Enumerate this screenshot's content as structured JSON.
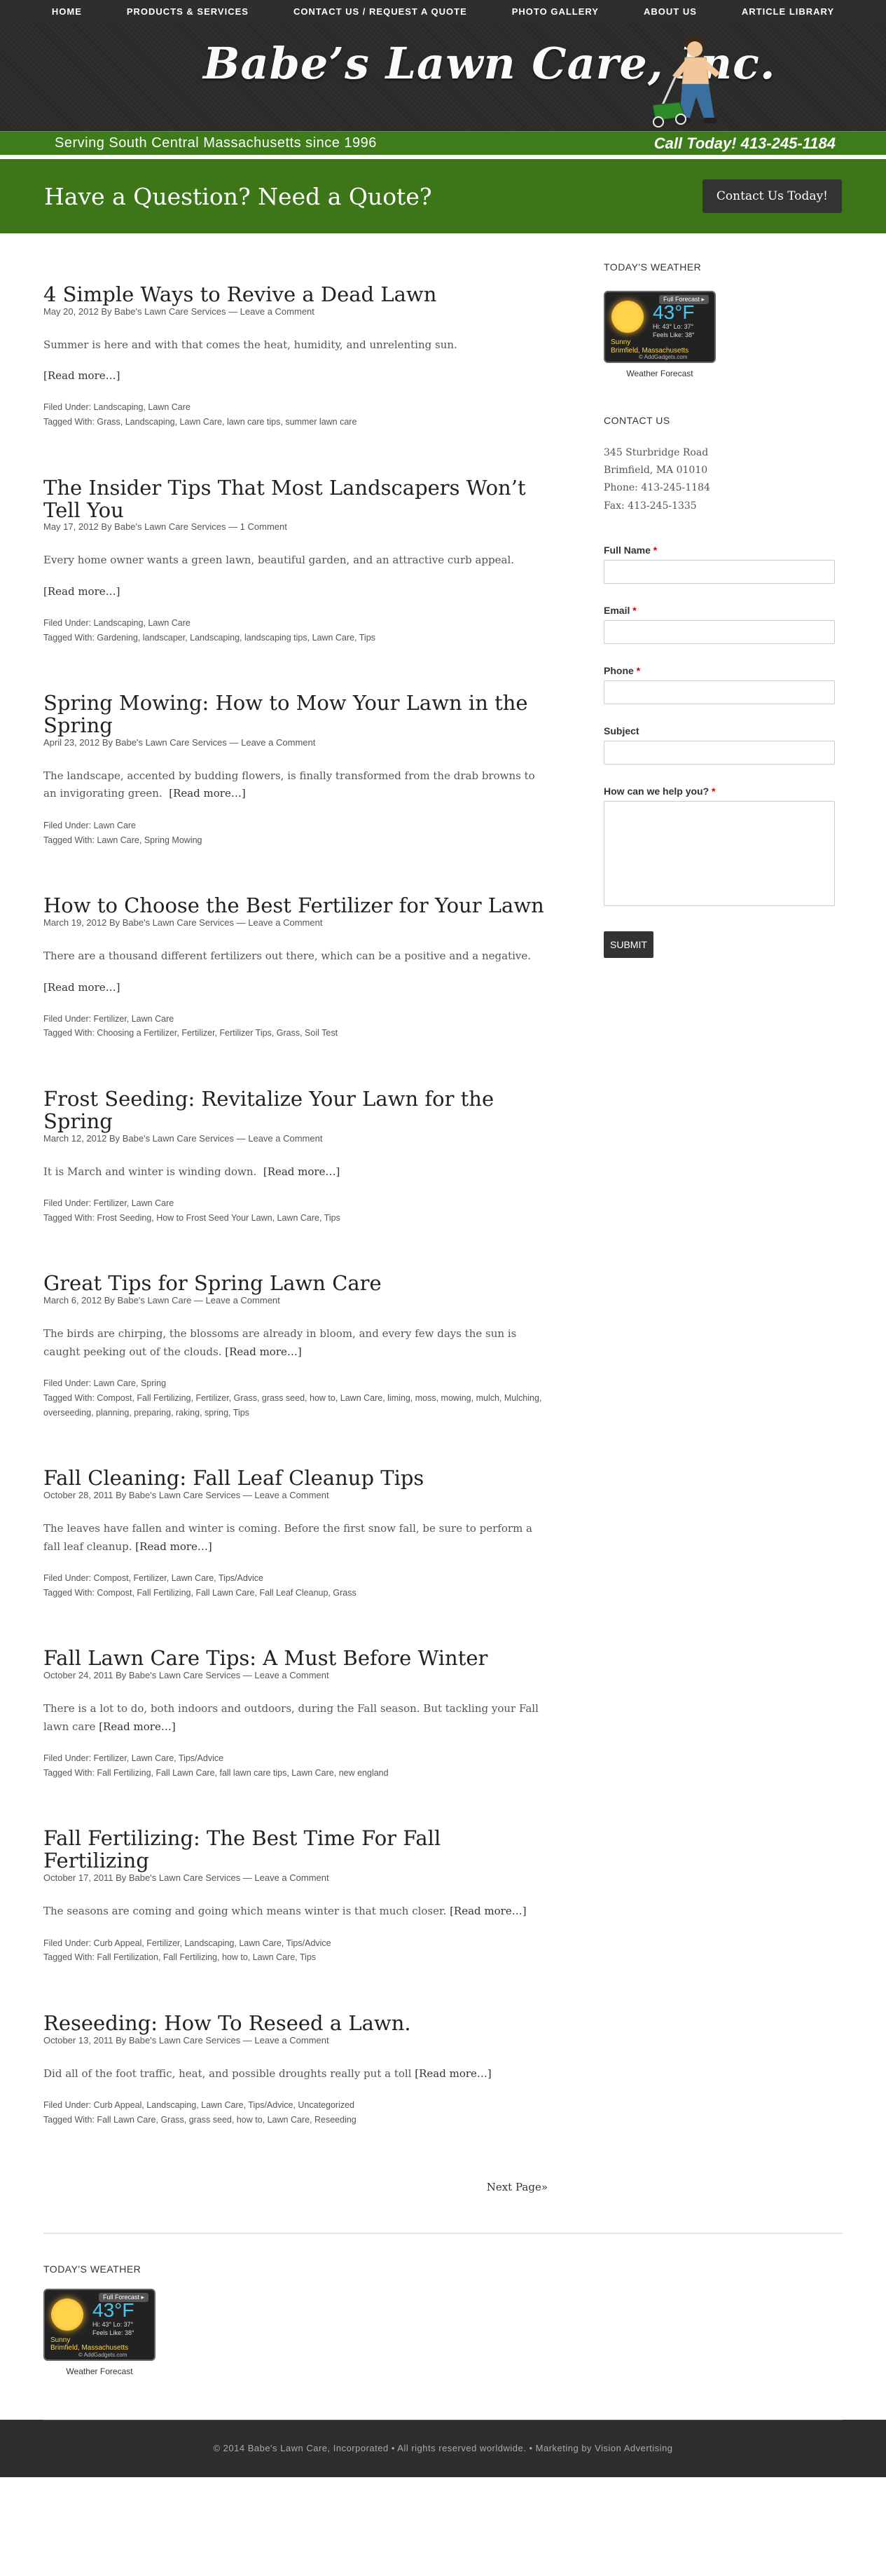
{
  "nav": {
    "items": [
      {
        "label": "HOME"
      },
      {
        "label": "PRODUCTS & SERVICES"
      },
      {
        "label": "CONTACT US / REQUEST A QUOTE"
      },
      {
        "label": "PHOTO GALLERY"
      },
      {
        "label": "ABOUT US"
      },
      {
        "label": "ARTICLE LIBRARY"
      }
    ]
  },
  "header": {
    "logo_text": "Babe’s Lawn Care, Inc.",
    "tagline": "Serving South Central Massachusetts since 1996",
    "call_text": "Call Today! 413-245-1184"
  },
  "quote_band": {
    "heading": "Have a Question? Need a Quote?",
    "button_label": "Contact Us Today!"
  },
  "posts": [
    {
      "title": "4 Simple Ways to Revive a Dead Lawn",
      "meta": "May 20, 2012 By Babe's Lawn Care Services — Leave a Comment",
      "excerpt": "Summer is here and with that comes the heat, humidity, and unrelenting sun.",
      "read_more": "[Read more…]",
      "filed": "Filed Under: Landscaping, Lawn Care",
      "tagged": "Tagged With: Grass, Landscaping, Lawn Care, lawn care tips, summer lawn care"
    },
    {
      "title": "The Insider Tips That Most Landscapers Won’t Tell You",
      "meta": "May 17, 2012 By Babe's Lawn Care Services — 1 Comment",
      "excerpt": "Every home owner wants a green lawn, beautiful garden, and an attractive curb appeal.",
      "read_more": "[Read more…]",
      "filed": "Filed Under: Landscaping, Lawn Care",
      "tagged": "Tagged With: Gardening, landscaper, Landscaping, landscaping tips, Lawn Care, Tips"
    },
    {
      "title": "Spring Mowing: How to Mow Your Lawn in the Spring",
      "meta": "April 23, 2012 By Babe's Lawn Care Services — Leave a Comment",
      "excerpt": "The landscape, accented by budding flowers, is finally transformed from the drab browns to an invigorating green.",
      "read_more": "[Read more…]",
      "filed": "Filed Under: Lawn Care",
      "tagged": "Tagged With: Lawn Care, Spring Mowing"
    },
    {
      "title": "How to Choose the Best Fertilizer for Your Lawn",
      "meta": "March 19, 2012 By Babe's Lawn Care Services — Leave a Comment",
      "excerpt": "There are a thousand different fertilizers out there, which can be a positive and a negative.",
      "read_more": "[Read more…]",
      "filed": "Filed Under: Fertilizer, Lawn Care",
      "tagged": "Tagged With: Choosing a Fertilizer, Fertilizer, Fertilizer Tips, Grass, Soil Test"
    },
    {
      "title": "Frost Seeding: Revitalize Your Lawn for the Spring",
      "meta": "March 12, 2012 By Babe's Lawn Care Services — Leave a Comment",
      "excerpt": "It is March and winter is winding down.",
      "read_more": "[Read more…]",
      "filed": "Filed Under: Fertilizer, Lawn Care",
      "tagged": "Tagged With: Frost Seeding, How to Frost Seed Your Lawn, Lawn Care, Tips"
    },
    {
      "title": "Great Tips for Spring Lawn Care",
      "meta": "March 6, 2012 By Babe's Lawn Care — Leave a Comment",
      "excerpt": "The birds are chirping, the blossoms are already in bloom, and every few days the sun is caught peeking out of the clouds.",
      "read_more": "[Read more…]",
      "filed": "Filed Under: Lawn Care, Spring",
      "tagged": "Tagged With: Compost, Fall Fertilizing, Fertilizer, Grass, grass seed, how to, Lawn Care, liming, moss, mowing, mulch, Mulching, overseeding, planning, preparing, raking, spring, Tips"
    },
    {
      "title": "Fall Cleaning: Fall Leaf Cleanup Tips",
      "meta": "October 28, 2011 By Babe's Lawn Care Services — Leave a Comment",
      "excerpt": "The leaves have fallen and winter is coming. Before the first snow fall, be sure to perform a fall leaf cleanup.",
      "read_more": "[Read more…]",
      "filed": "Filed Under: Compost, Fertilizer, Lawn Care, Tips/Advice",
      "tagged": "Tagged With: Compost, Fall Fertilizing, Fall Lawn Care, Fall Leaf Cleanup, Grass"
    },
    {
      "title": "Fall Lawn Care Tips: A Must Before Winter",
      "meta": "October 24, 2011 By Babe's Lawn Care Services — Leave a Comment",
      "excerpt": "There is a lot to do, both indoors and outdoors, during the Fall season. But tackling your Fall lawn care",
      "read_more": "[Read more…]",
      "filed": "Filed Under: Fertilizer, Lawn Care, Tips/Advice",
      "tagged": "Tagged With: Fall Fertilizing, Fall Lawn Care, fall lawn care tips, Lawn Care, new england"
    },
    {
      "title": "Fall Fertilizing: The Best Time For Fall Fertilizing",
      "meta": "October 17, 2011 By Babe's Lawn Care Services — Leave a Comment",
      "excerpt": "The seasons are coming and going which means winter is that much closer.",
      "read_more": "[Read more…]",
      "filed": "Filed Under: Curb Appeal, Fertilizer, Landscaping, Lawn Care, Tips/Advice",
      "tagged": "Tagged With: Fall Fertilization, Fall Fertilizing, how to, Lawn Care, Tips"
    },
    {
      "title": "Reseeding: How To Reseed a Lawn.",
      "meta": "October 13, 2011 By Babe's Lawn Care Services — Leave a Comment",
      "excerpt": "Did all of the foot traffic, heat, and possible droughts really put a toll",
      "read_more": "[Read more…]",
      "filed": "Filed Under: Curb Appeal, Landscaping, Lawn Care, Tips/Advice, Uncategorized",
      "tagged": "Tagged With: Fall Lawn Care, Grass, grass seed, how to, Lawn Care, Reseeding"
    }
  ],
  "pagination": {
    "next_label": "Next Page»"
  },
  "weather": {
    "title": "TODAY'S WEATHER",
    "forecast_tab": "Full Forecast ▸",
    "temp": "43°F",
    "hilo": "Hi: 43°  Lo: 37°",
    "feels": "Feels Like: 38°",
    "condition": "Sunny",
    "location": "Brimfield, Massachusetts",
    "brand": "© AddGadgets.com",
    "caption": "Weather Forecast"
  },
  "contact": {
    "title": "CONTACT US",
    "address1": "345 Sturbridge Road",
    "address2": "Brimfield, MA 01010",
    "phone": "Phone: 413-245-1184",
    "fax": "Fax: 413-245-1335"
  },
  "form": {
    "full_name": "Full Name",
    "email": "Email",
    "phone": "Phone",
    "subject": "Subject",
    "message": "How can we help you?",
    "required_mark": "*",
    "submit": "SUBMIT"
  },
  "footer": {
    "text": "© 2014 Babe's Lawn Care, Incorporated • All rights reserved worldwide. • Marketing by Vision Advertising"
  },
  "colors": {
    "brand_green": "#3e7b1b",
    "dark": "#2e2e2e"
  }
}
